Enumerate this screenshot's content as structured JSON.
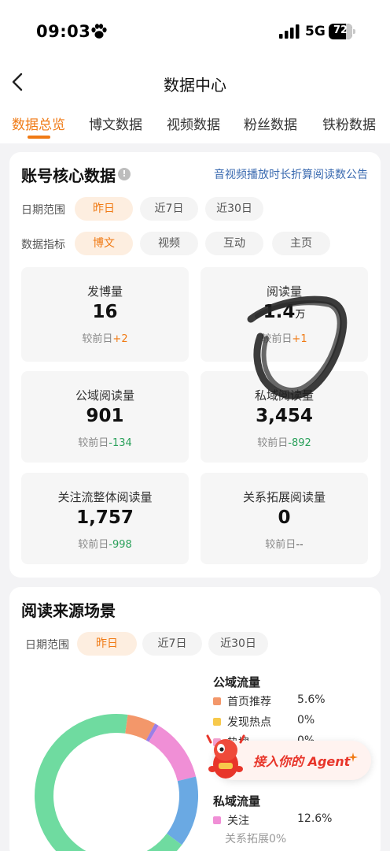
{
  "status_bar": {
    "time": "09:03",
    "network": "5G",
    "battery": "72",
    "battery_level": 0.72
  },
  "nav": {
    "title": "数据中心"
  },
  "tabs": [
    {
      "label": "数据总览",
      "active": true
    },
    {
      "label": "博文数据",
      "active": false
    },
    {
      "label": "视频数据",
      "active": false
    },
    {
      "label": "粉丝数据",
      "active": false
    },
    {
      "label": "铁粉数据",
      "active": false
    }
  ],
  "core_card": {
    "title": "账号核心数据",
    "info_icon": "info-icon",
    "notice": "音视频播放时长折算阅读数公告",
    "date_range": {
      "label": "日期范围",
      "options": [
        "昨日",
        "近7日",
        "近30日"
      ],
      "selected": "昨日"
    },
    "metric": {
      "label": "数据指标",
      "options": [
        "博文",
        "视频",
        "互动",
        "主页"
      ],
      "selected": "博文"
    },
    "stats": [
      {
        "label": "发博量",
        "value": "16",
        "unit": "",
        "compare_prefix": "较前日",
        "change": "+2",
        "trend": "up"
      },
      {
        "label": "阅读量",
        "value": "1.4",
        "unit": "万",
        "compare_prefix": "较前日",
        "change": "+1",
        "trend": "up"
      },
      {
        "label": "公域阅读量",
        "value": "901",
        "unit": "",
        "compare_prefix": "较前日",
        "change": "-134",
        "trend": "down"
      },
      {
        "label": "私域阅读量",
        "value": "3,454",
        "unit": "",
        "compare_prefix": "较前日",
        "change": "-892",
        "trend": "down"
      },
      {
        "label": "关注流整体阅读量",
        "value": "1,757",
        "unit": "",
        "compare_prefix": "较前日",
        "change": "-998",
        "trend": "down"
      },
      {
        "label": "关系拓展阅读量",
        "value": "0",
        "unit": "",
        "compare_prefix": "较前日",
        "change": "--",
        "trend": "neutral"
      }
    ]
  },
  "source_card": {
    "title": "阅读来源场景",
    "date_range": {
      "label": "日期范围",
      "options": [
        "昨日",
        "近7日",
        "近30日"
      ],
      "selected": "昨日"
    },
    "public_title": "公域流量",
    "public_items": [
      {
        "name": "首页推荐",
        "pct": "5.6%",
        "color": "#f3976a"
      },
      {
        "name": "发现热点",
        "pct": "0%",
        "color": "#f7c94b"
      },
      {
        "name": "热搜",
        "pct": "0%",
        "color": "#f1a0cf"
      }
    ],
    "private_title": "私域流量",
    "private_items": [
      {
        "name": "关注",
        "pct": "12.6%",
        "color": "#f08fd6"
      }
    ],
    "private_sub": "关系拓展0%",
    "chart_data": {
      "type": "pie",
      "labels": [
        "首页推荐",
        "发现热点",
        "热搜",
        "关注",
        "蓝色分段",
        "绿色分段"
      ],
      "values": [
        5.6,
        0.8,
        0,
        12.6,
        14,
        67
      ],
      "colors": [
        "#f3976a",
        "#9b7fe6",
        "#f1a0cf",
        "#f08fd6",
        "#6aa9e3",
        "#6fdba0"
      ]
    }
  },
  "agent": {
    "label": "接入你的 Agent"
  },
  "colors": {
    "accent": "#f07a14",
    "down": "#2aa05a",
    "link": "#3a6ab0"
  }
}
